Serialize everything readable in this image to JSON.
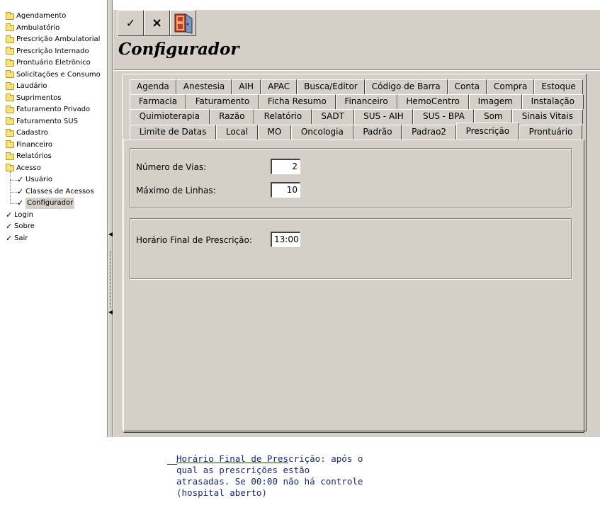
{
  "sidebar": {
    "items": [
      {
        "label": "Agendamento",
        "icon": "folder-icon"
      },
      {
        "label": "Ambulatório",
        "icon": "folder-icon"
      },
      {
        "label": "Prescrição Ambulatorial",
        "icon": "folder-icon"
      },
      {
        "label": "Prescrição Internado",
        "icon": "folder-icon"
      },
      {
        "label": "Prontuário Eletrônico",
        "icon": "folder-icon"
      },
      {
        "label": "Solicitações e Consumo",
        "icon": "folder-icon"
      },
      {
        "label": "Laudário",
        "icon": "folder-icon"
      },
      {
        "label": "Suprimentos",
        "icon": "folder-icon"
      },
      {
        "label": "Faturamento Privado",
        "icon": "folder-icon"
      },
      {
        "label": "Faturamento SUS",
        "icon": "folder-icon"
      },
      {
        "label": "Cadastro",
        "icon": "folder-icon"
      },
      {
        "label": "Financeiro",
        "icon": "folder-icon"
      },
      {
        "label": "Relatórios",
        "icon": "folder-icon"
      },
      {
        "label": "Acesso",
        "icon": "folder-open-icon"
      }
    ],
    "acesso_children": [
      {
        "label": "Usuário",
        "icon": "check-icon"
      },
      {
        "label": "Classes de Acessos",
        "icon": "check-icon"
      },
      {
        "label": "Configurador",
        "icon": "check-icon",
        "selected": true
      }
    ],
    "bottom_items": [
      {
        "label": "Login",
        "icon": "check-icon"
      },
      {
        "label": "Sobre",
        "icon": "check-icon"
      },
      {
        "label": "Sair",
        "icon": "check-icon"
      }
    ]
  },
  "toolbar": {
    "confirm_glyph": "✓",
    "cancel_glyph": "×",
    "exit_icon": "exit-door-icon"
  },
  "form": {
    "title": "Configurador"
  },
  "tabs": {
    "row1": [
      "Agenda",
      "Anestesia",
      "AIH",
      "APAC",
      "Busca/Editor",
      "Código de Barra",
      "Conta",
      "Compra",
      "Estoque"
    ],
    "row2": [
      "Farmacia",
      "Faturamento",
      "Ficha Resumo",
      "Financeiro",
      "HemoCentro",
      "Imagem",
      "Instalação"
    ],
    "row3": [
      "Quimioterapia",
      "Razão",
      "Relatório",
      "SADT",
      "SUS - AIH",
      "SUS - BPA",
      "Som",
      "Sinais Vitais"
    ],
    "row4": [
      "Limite de Datas",
      "Local",
      "MO",
      "Oncologia",
      "Padrão",
      "Padrao2",
      "Prescrição",
      "Prontuário"
    ],
    "active": "Prescrição"
  },
  "prescricao": {
    "numero_vias_label": "Número de Vias:",
    "numero_vias_value": "2",
    "maximo_linhas_label": "Máximo de Linhas:",
    "maximo_linhas_value": "10",
    "horario_final_label": "Horário Final de Prescrição:",
    "horario_final_value": "13:00"
  },
  "help_note": {
    "link_text": "Horário Final de Pres",
    "rest_text": "crição: após o qual as prescrições estão atrasadas. Se 00:00 não há controle (hospital aberto)"
  },
  "colors": {
    "face": "#d4d0c8",
    "note_text": "#1a2a6e",
    "folder": "#f6e37a"
  }
}
